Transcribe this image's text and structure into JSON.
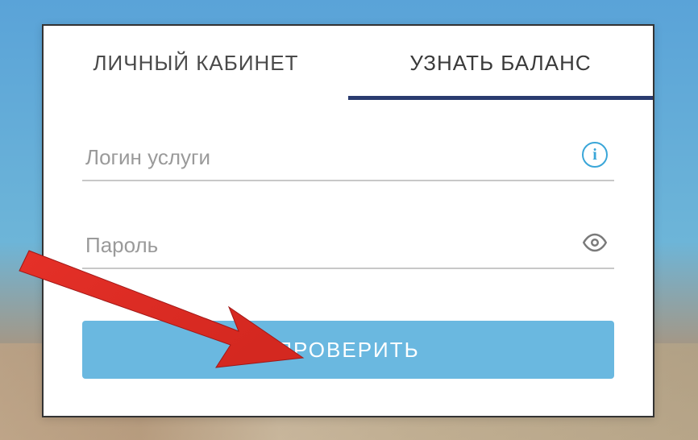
{
  "tabs": {
    "account": "ЛИЧНЫЙ КАБИНЕТ",
    "balance": "УЗНАТЬ БАЛАНС"
  },
  "fields": {
    "login_placeholder": "Логин услуги",
    "password_placeholder": "Пароль"
  },
  "buttons": {
    "submit": "ПРОВЕРИТЬ"
  },
  "icons": {
    "info": "i"
  }
}
